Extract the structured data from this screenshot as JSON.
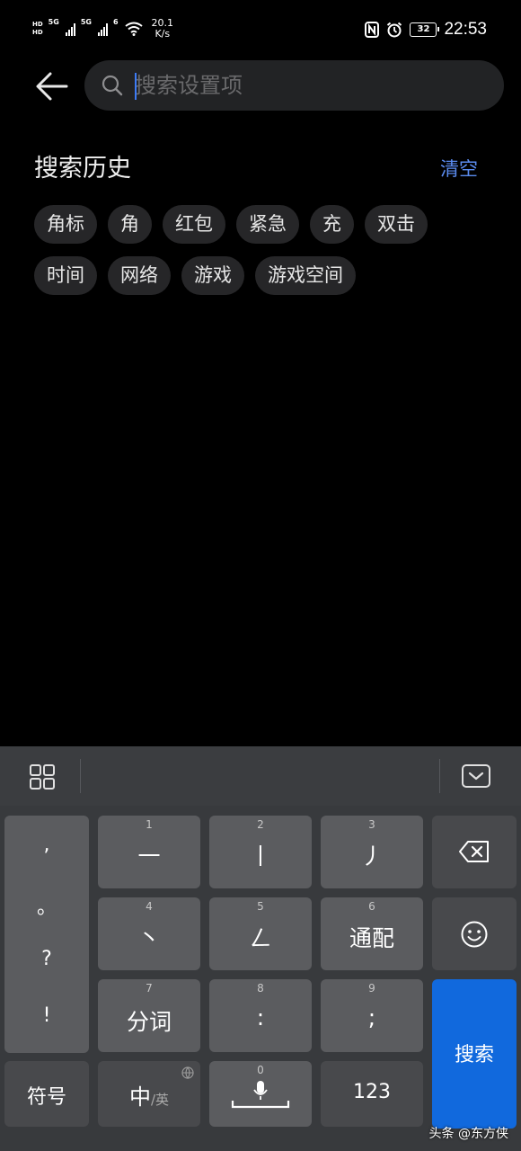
{
  "status_bar": {
    "hd1": "HD",
    "hd2": "HD",
    "net1": "5G",
    "net2": "5G",
    "wifi_label": "6",
    "speed_value": "20.1",
    "speed_unit": "K/s",
    "battery_level": "32",
    "time": "22:53"
  },
  "search": {
    "placeholder": "搜索设置项",
    "value": ""
  },
  "history": {
    "title": "搜索历史",
    "clear_label": "清空",
    "chips": [
      "角标",
      "角",
      "红包",
      "紧急",
      "充",
      "双击",
      "时间",
      "网络",
      "游戏",
      "游戏空间"
    ]
  },
  "keyboard": {
    "punct": [
      ",",
      "。",
      "?",
      "!"
    ],
    "keys": {
      "k1": {
        "num": "1",
        "label": "一"
      },
      "k2": {
        "num": "2",
        "label": "丨"
      },
      "k3": {
        "num": "3",
        "label": "丿"
      },
      "k4": {
        "num": "4",
        "label": "丶"
      },
      "k5": {
        "num": "5",
        "label": "ㄥ"
      },
      "k6": {
        "num": "6",
        "label": "通配"
      },
      "k7": {
        "num": "7",
        "label": "分词"
      },
      "k8": {
        "num": "8",
        "label": ":"
      },
      "k9": {
        "num": "9",
        "label": ";"
      },
      "k0": {
        "num": "0"
      }
    },
    "symbol_label": "符号",
    "lang_main": "中",
    "lang_alt": "/英",
    "num_label": "123",
    "search_label": "搜索"
  },
  "watermark": "头条 @东方侠",
  "colors": {
    "accent": "#5b8cf0",
    "search_key": "#1169dd",
    "caret": "#3d7bf5"
  }
}
